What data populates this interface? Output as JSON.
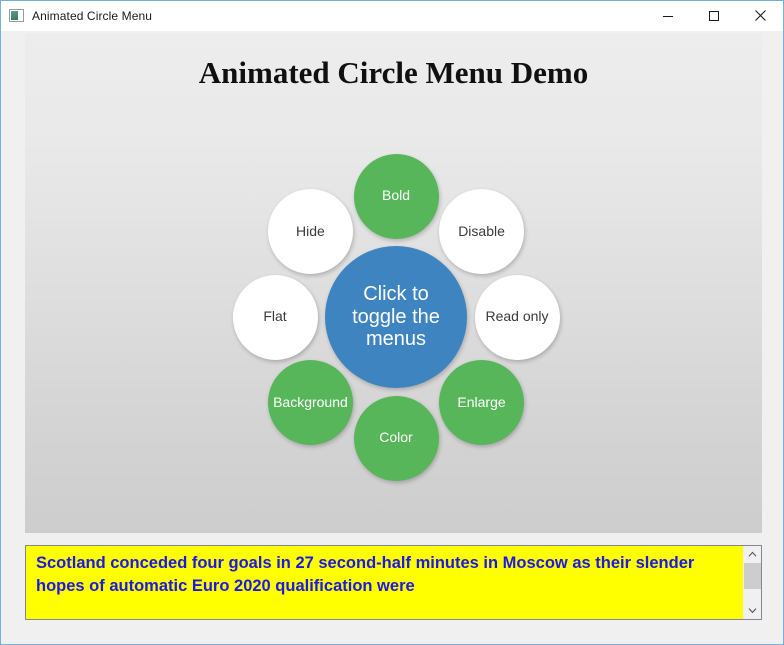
{
  "window": {
    "title": "Animated Circle Menu",
    "icon": "window-image-icon",
    "controls": {
      "minimize": "minimize-icon",
      "maximize": "maximize-icon",
      "close": "close-icon"
    },
    "border_color": "#7aaeda",
    "background": "#f0f0f0"
  },
  "demo": {
    "heading": "Animated Circle Menu Demo",
    "panel_gradient_top": "#ededed",
    "panel_gradient_bottom": "#cdcdcd"
  },
  "circle_menu": {
    "center": {
      "label": "Click to toggle the menus",
      "color": "#3e84c0",
      "text_color": "#ffffff"
    },
    "green_color": "#57b55a",
    "white_color": "#ffffff",
    "nodes": [
      {
        "label": "Bold",
        "style": "green",
        "angle_deg": 270
      },
      {
        "label": "Disable",
        "style": "white",
        "angle_deg": 315
      },
      {
        "label": "Read only",
        "style": "white",
        "angle_deg": 0
      },
      {
        "label": "Enlarge",
        "style": "green",
        "angle_deg": 45
      },
      {
        "label": "Color",
        "style": "green",
        "angle_deg": 90
      },
      {
        "label": "Background",
        "style": "green",
        "angle_deg": 135
      },
      {
        "label": "Flat",
        "style": "white",
        "angle_deg": 180
      },
      {
        "label": "Hide",
        "style": "white",
        "angle_deg": 225
      }
    ]
  },
  "textbox": {
    "value": "Scotland conceded four goals in 27 second-half minutes in Moscow as their slender hopes of automatic Euro 2020 qualification were",
    "background": "#ffff00",
    "text_color": "#1b19e6",
    "scrollbar": {
      "up_arrow": "chevron-up-icon",
      "down_arrow": "chevron-down-icon"
    }
  }
}
